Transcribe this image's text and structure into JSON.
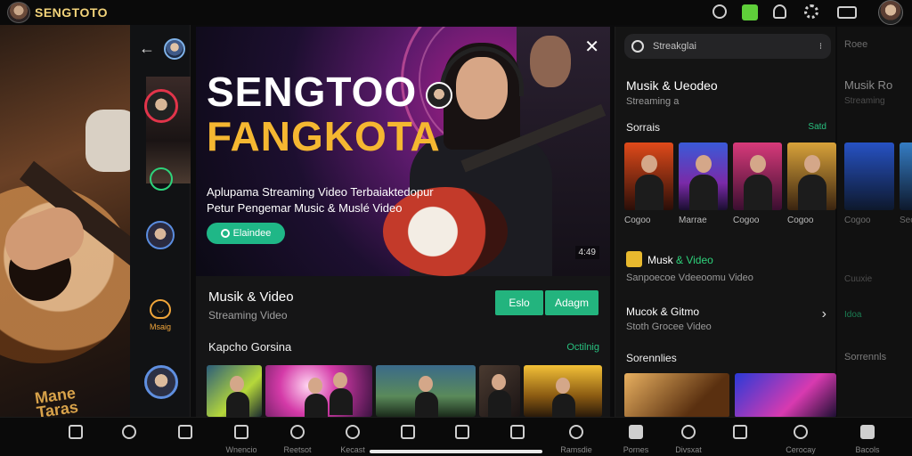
{
  "topbar": {
    "app_title": "SENGTOTO",
    "icons": [
      "refresh-icon",
      "cast-icon",
      "bell-icon",
      "settings-icon",
      "screen-icon"
    ]
  },
  "left_bg": {
    "logo_text": "Mane\nTaras"
  },
  "rail": {
    "back": "←",
    "face_label": "Msaig"
  },
  "hero": {
    "close": "✕",
    "title_line1": "SENGTOO",
    "title_line2": "FANGKOTA",
    "desc_line1": "Aplupama Streaming Video Terbaiaktedopur",
    "desc_line2": "Petur Pengemar Music & Muslé Video",
    "cta_label": "Elaindee",
    "duration": "4:49"
  },
  "info": {
    "title": "Musik & Video",
    "subtitle": "Streaming Video",
    "btn_primary": "Eslo",
    "btn_secondary": "Adagm",
    "section_label": "Kapcho Gorsina",
    "section_link": "Octilnig"
  },
  "right": {
    "search_placeholder": "Streakglai",
    "title": "Musik & Ueodeo",
    "subtitle": "Streaming a",
    "section1": "Sorrais",
    "section1_link": "Satd",
    "thumb_captions": [
      "Cogoo",
      "Marrae",
      "Cogoo",
      "Cogoo"
    ],
    "item_title_a": "Musk ",
    "item_title_b": "& Video",
    "item_sub": "Sanpoecoe Vdeeoomu Video",
    "row2_title": "Mucok & Gitmo",
    "row2_sub": "Stoth Grocee Video",
    "section2": "Sorennlies"
  },
  "ghost": {
    "search": "Roee",
    "title": "Musik Ro",
    "sub": "Streaming",
    "cap1": "Cogoo",
    "cap2": "Seoss",
    "row1": "Cuuxie",
    "row2": "Idoa",
    "section": "Sorrennls"
  },
  "bottomnav": {
    "items": [
      {
        "label": "",
        "icon": "home-icon"
      },
      {
        "label": "",
        "icon": "heart-icon"
      },
      {
        "label": "",
        "icon": "library-icon"
      },
      {
        "label": "Wnencio",
        "icon": "square-icon"
      },
      {
        "label": "Reetsot",
        "icon": "chat-icon"
      },
      {
        "label": "Kecast",
        "icon": "refresh-icon"
      },
      {
        "label": "",
        "icon": "playlist-icon"
      },
      {
        "label": "",
        "icon": "bag-icon"
      },
      {
        "label": "",
        "icon": "book-icon"
      },
      {
        "label": "Ramsdie",
        "icon": "user-icon"
      },
      {
        "label": "Pornes",
        "icon": "home-icon"
      },
      {
        "label": "Divsxat",
        "icon": "search-icon"
      },
      {
        "label": "",
        "icon": "message-icon"
      },
      {
        "label": "Cerocay",
        "icon": "user-icon"
      },
      {
        "label": "Bacols",
        "icon": "bag-icon"
      }
    ]
  },
  "colors": {
    "accent_green": "#23b47e",
    "title_gold": "#f5b731",
    "brand_gold": "#f2d37a"
  }
}
